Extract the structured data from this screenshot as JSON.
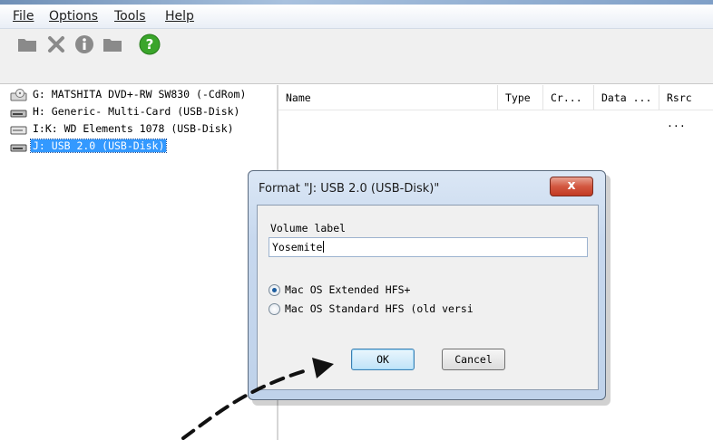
{
  "menubar": {
    "items": [
      {
        "label": "File"
      },
      {
        "label": "Options"
      },
      {
        "label": "Tools"
      },
      {
        "label": "Help"
      }
    ]
  },
  "toolbar": {
    "icons": [
      "folder-icon",
      "delete-x-icon",
      "info-icon",
      "folder-icon",
      "help-icon"
    ]
  },
  "drives": [
    {
      "label": "G: MATSHITA DVD+-RW SW830 (-CdRom)",
      "icon": "cdrom-drive-icon"
    },
    {
      "label": "H: Generic- Multi-Card (USB-Disk)",
      "icon": "usb-disk-icon"
    },
    {
      "label": "I:K: WD Elements 1078 (USB-Disk)",
      "icon": "external-disk-icon"
    },
    {
      "label": "J:  USB 2.0 (USB-Disk)",
      "icon": "usb-disk-icon",
      "selected": true
    }
  ],
  "columns": [
    "Name",
    "Type",
    "Cr...",
    "Data ...",
    "Rsrc ..."
  ],
  "dialog": {
    "title": "Format \"J:  USB 2.0 (USB-Disk)\"",
    "close_label": "x",
    "volume_label_caption": "Volume label",
    "volume_label_value": "Yosemite",
    "options": [
      {
        "label": "Mac OS Extended HFS+",
        "checked": true
      },
      {
        "label": "Mac OS Standard HFS (old versi",
        "checked": false
      }
    ],
    "ok_label": "OK",
    "cancel_label": "Cancel"
  },
  "colors": {
    "selection": "#3399ff",
    "dialog_frame": "#c7d8ee",
    "close_button": "#d35740",
    "help_icon": "#3aa52b"
  }
}
